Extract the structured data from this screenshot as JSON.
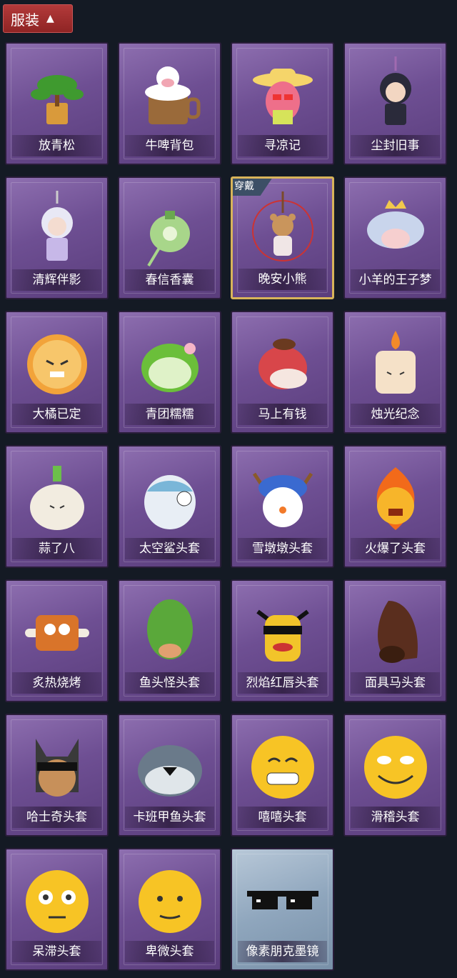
{
  "header": {
    "title": "服装",
    "chevron": "chevron-up-icon"
  },
  "items": [
    {
      "label": "放青松",
      "icon": "bonsai-pine-icon"
    },
    {
      "label": "牛啤背包",
      "icon": "cow-beer-mug-icon"
    },
    {
      "label": "寻凉记",
      "icon": "pink-creature-sunhat-icon"
    },
    {
      "label": "尘封旧事",
      "icon": "dark-hair-chibi-keychain-icon"
    },
    {
      "label": "清辉伴影",
      "icon": "white-hair-chibi-keychain-icon"
    },
    {
      "label": "春信香囊",
      "icon": "green-sachet-icon"
    },
    {
      "label": "晚安小熊",
      "icon": "bear-keychain-icon",
      "badge": "穿戴",
      "selected": true
    },
    {
      "label": "小羊的王子梦",
      "icon": "crowned-sheep-icon"
    },
    {
      "label": "大橘已定",
      "icon": "orange-slice-face-icon"
    },
    {
      "label": "青团糯糯",
      "icon": "green-rice-ball-icon"
    },
    {
      "label": "马上有钱",
      "icon": "red-horse-head-icon"
    },
    {
      "label": "烛光纪念",
      "icon": "candle-face-icon"
    },
    {
      "label": "蒜了八",
      "icon": "garlic-face-icon"
    },
    {
      "label": "太空鲨头套",
      "icon": "shark-head-icon"
    },
    {
      "label": "雪墩墩头套",
      "icon": "snowman-reindeer-head-icon"
    },
    {
      "label": "火爆了头套",
      "icon": "fire-face-icon"
    },
    {
      "label": "炙热烧烤",
      "icon": "sausage-bone-icon"
    },
    {
      "label": "鱼头怪头套",
      "icon": "fish-mask-icon"
    },
    {
      "label": "烈焰红唇头套",
      "icon": "yellow-mask-sunglasses-icon"
    },
    {
      "label": "面具马头套",
      "icon": "horse-mask-icon"
    },
    {
      "label": "哈士奇头套",
      "icon": "husky-sunglasses-icon"
    },
    {
      "label": "卡班甲鱼头套",
      "icon": "grey-fish-head-icon"
    },
    {
      "label": "嘻嘻头套",
      "icon": "grin-emoji-icon"
    },
    {
      "label": "滑稽头套",
      "icon": "funny-smirk-emoji-icon"
    },
    {
      "label": "呆滞头套",
      "icon": "stare-emoji-icon"
    },
    {
      "label": "卑微头套",
      "icon": "humble-emoji-icon"
    },
    {
      "label": "像素朋克墨镜",
      "icon": "pixel-sunglasses-icon",
      "variant": "blue"
    }
  ],
  "colors": {
    "accent_red": "#a32e2e",
    "card_purple": "#7a5a9e",
    "card_blue": "#8fa6bd",
    "selected_gold": "#d8b45a"
  }
}
